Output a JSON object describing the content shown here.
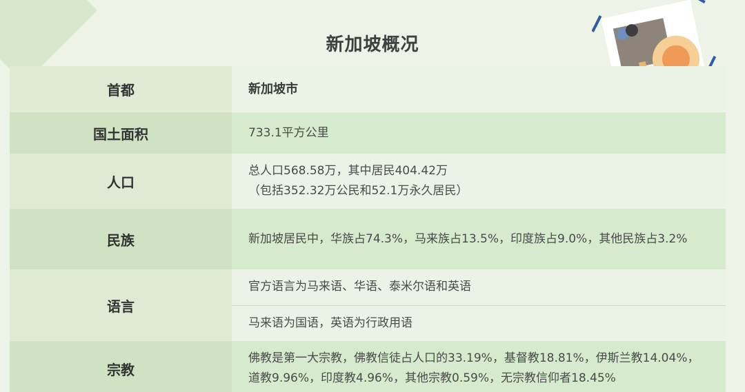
{
  "title": "新加坡概况",
  "rows": [
    {
      "label": "首都",
      "value": "新加坡市"
    },
    {
      "label": "国土面积",
      "value": "733.1平方公里"
    },
    {
      "label": "人口",
      "lines": [
        "总人口568.58万，其中居民404.42万",
        "（包括352.32万公民和52.1万永久居民）"
      ]
    },
    {
      "label": "民族",
      "value": "新加坡居民中，华族占74.3%，马来族占13.5%，印度族占9.0%，其他民族占3.2%"
    },
    {
      "label": "语言",
      "lines": [
        "官方语言为马来语、华语、泰米尔语和英语",
        "马来语为国语，英语为行政用语"
      ]
    },
    {
      "label": "宗教",
      "lines": [
        "佛教是第一大宗教，佛教信徒占人口的33.19%，基督教18.81%，伊斯兰教14.04%，",
        "道教9.96%，印度教4.96%，其他宗教0.59%，无宗教信仰者18.45%"
      ]
    }
  ],
  "colors": {
    "background": "#edf3e6",
    "row_dark": "#d6eacd",
    "row_light": "#ebf3e6",
    "frame_blue": "#2f5ba8"
  },
  "icons": {
    "decoration": "framed-abstract-art-icon"
  }
}
